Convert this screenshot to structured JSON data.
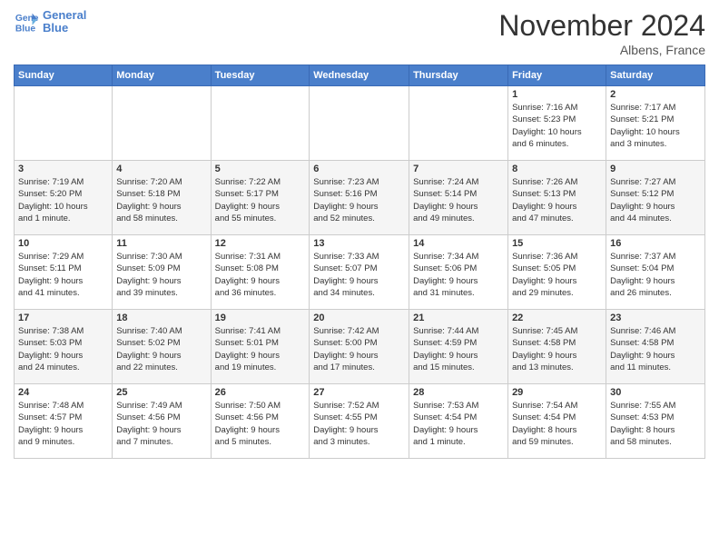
{
  "header": {
    "logo_line1": "General",
    "logo_line2": "Blue",
    "month_title": "November 2024",
    "location": "Albens, France"
  },
  "weekdays": [
    "Sunday",
    "Monday",
    "Tuesday",
    "Wednesday",
    "Thursday",
    "Friday",
    "Saturday"
  ],
  "weeks": [
    [
      {
        "day": "",
        "info": ""
      },
      {
        "day": "",
        "info": ""
      },
      {
        "day": "",
        "info": ""
      },
      {
        "day": "",
        "info": ""
      },
      {
        "day": "",
        "info": ""
      },
      {
        "day": "1",
        "info": "Sunrise: 7:16 AM\nSunset: 5:23 PM\nDaylight: 10 hours\nand 6 minutes."
      },
      {
        "day": "2",
        "info": "Sunrise: 7:17 AM\nSunset: 5:21 PM\nDaylight: 10 hours\nand 3 minutes."
      }
    ],
    [
      {
        "day": "3",
        "info": "Sunrise: 7:19 AM\nSunset: 5:20 PM\nDaylight: 10 hours\nand 1 minute."
      },
      {
        "day": "4",
        "info": "Sunrise: 7:20 AM\nSunset: 5:18 PM\nDaylight: 9 hours\nand 58 minutes."
      },
      {
        "day": "5",
        "info": "Sunrise: 7:22 AM\nSunset: 5:17 PM\nDaylight: 9 hours\nand 55 minutes."
      },
      {
        "day": "6",
        "info": "Sunrise: 7:23 AM\nSunset: 5:16 PM\nDaylight: 9 hours\nand 52 minutes."
      },
      {
        "day": "7",
        "info": "Sunrise: 7:24 AM\nSunset: 5:14 PM\nDaylight: 9 hours\nand 49 minutes."
      },
      {
        "day": "8",
        "info": "Sunrise: 7:26 AM\nSunset: 5:13 PM\nDaylight: 9 hours\nand 47 minutes."
      },
      {
        "day": "9",
        "info": "Sunrise: 7:27 AM\nSunset: 5:12 PM\nDaylight: 9 hours\nand 44 minutes."
      }
    ],
    [
      {
        "day": "10",
        "info": "Sunrise: 7:29 AM\nSunset: 5:11 PM\nDaylight: 9 hours\nand 41 minutes."
      },
      {
        "day": "11",
        "info": "Sunrise: 7:30 AM\nSunset: 5:09 PM\nDaylight: 9 hours\nand 39 minutes."
      },
      {
        "day": "12",
        "info": "Sunrise: 7:31 AM\nSunset: 5:08 PM\nDaylight: 9 hours\nand 36 minutes."
      },
      {
        "day": "13",
        "info": "Sunrise: 7:33 AM\nSunset: 5:07 PM\nDaylight: 9 hours\nand 34 minutes."
      },
      {
        "day": "14",
        "info": "Sunrise: 7:34 AM\nSunset: 5:06 PM\nDaylight: 9 hours\nand 31 minutes."
      },
      {
        "day": "15",
        "info": "Sunrise: 7:36 AM\nSunset: 5:05 PM\nDaylight: 9 hours\nand 29 minutes."
      },
      {
        "day": "16",
        "info": "Sunrise: 7:37 AM\nSunset: 5:04 PM\nDaylight: 9 hours\nand 26 minutes."
      }
    ],
    [
      {
        "day": "17",
        "info": "Sunrise: 7:38 AM\nSunset: 5:03 PM\nDaylight: 9 hours\nand 24 minutes."
      },
      {
        "day": "18",
        "info": "Sunrise: 7:40 AM\nSunset: 5:02 PM\nDaylight: 9 hours\nand 22 minutes."
      },
      {
        "day": "19",
        "info": "Sunrise: 7:41 AM\nSunset: 5:01 PM\nDaylight: 9 hours\nand 19 minutes."
      },
      {
        "day": "20",
        "info": "Sunrise: 7:42 AM\nSunset: 5:00 PM\nDaylight: 9 hours\nand 17 minutes."
      },
      {
        "day": "21",
        "info": "Sunrise: 7:44 AM\nSunset: 4:59 PM\nDaylight: 9 hours\nand 15 minutes."
      },
      {
        "day": "22",
        "info": "Sunrise: 7:45 AM\nSunset: 4:58 PM\nDaylight: 9 hours\nand 13 minutes."
      },
      {
        "day": "23",
        "info": "Sunrise: 7:46 AM\nSunset: 4:58 PM\nDaylight: 9 hours\nand 11 minutes."
      }
    ],
    [
      {
        "day": "24",
        "info": "Sunrise: 7:48 AM\nSunset: 4:57 PM\nDaylight: 9 hours\nand 9 minutes."
      },
      {
        "day": "25",
        "info": "Sunrise: 7:49 AM\nSunset: 4:56 PM\nDaylight: 9 hours\nand 7 minutes."
      },
      {
        "day": "26",
        "info": "Sunrise: 7:50 AM\nSunset: 4:56 PM\nDaylight: 9 hours\nand 5 minutes."
      },
      {
        "day": "27",
        "info": "Sunrise: 7:52 AM\nSunset: 4:55 PM\nDaylight: 9 hours\nand 3 minutes."
      },
      {
        "day": "28",
        "info": "Sunrise: 7:53 AM\nSunset: 4:54 PM\nDaylight: 9 hours\nand 1 minute."
      },
      {
        "day": "29",
        "info": "Sunrise: 7:54 AM\nSunset: 4:54 PM\nDaylight: 8 hours\nand 59 minutes."
      },
      {
        "day": "30",
        "info": "Sunrise: 7:55 AM\nSunset: 4:53 PM\nDaylight: 8 hours\nand 58 minutes."
      }
    ]
  ]
}
